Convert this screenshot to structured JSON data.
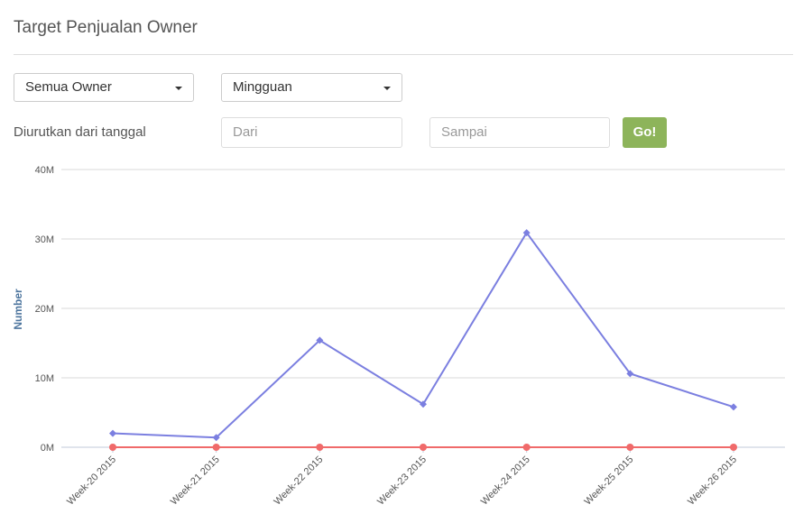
{
  "page": {
    "title": "Target Penjualan Owner"
  },
  "filters": {
    "owner_select": "Semua Owner",
    "period_select": "Mingguan",
    "date_label": "Diurutkan dari tanggal",
    "from_placeholder": "Dari",
    "to_placeholder": "Sampai",
    "go_label": "Go!"
  },
  "chart_data": {
    "type": "line",
    "title": "",
    "xlabel": "",
    "ylabel": "Number",
    "categories": [
      "Week-20 2015",
      "Week-21 2015",
      "Week-22 2015",
      "Week-23 2015",
      "Week-24 2015",
      "Week-25 2015",
      "Week-26 2015"
    ],
    "yticks": [
      "0M",
      "10M",
      "20M",
      "30M",
      "40M"
    ],
    "ylim": [
      0,
      40000000
    ],
    "grid": true,
    "series": [
      {
        "color": "#7b7fe0",
        "marker": "diamond",
        "values": [
          2000000,
          1400000,
          15400000,
          6200000,
          30900000,
          10600000,
          5800000
        ]
      },
      {
        "color": "#f06a6a",
        "marker": "circle",
        "values": [
          0,
          0,
          0,
          0,
          0,
          0,
          0
        ]
      }
    ]
  }
}
